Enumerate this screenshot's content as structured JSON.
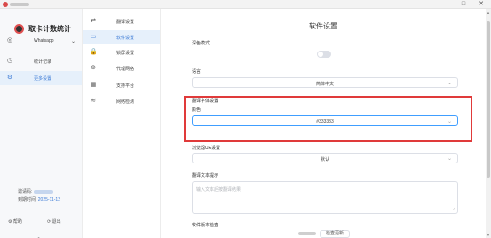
{
  "window": {
    "minimize": "–",
    "maximize": "□",
    "close": "✕"
  },
  "sidebar": {
    "app_title": "取卡计数统计",
    "items": [
      {
        "label": "Whatsapp",
        "icon": "whatsapp-icon",
        "glyph": "◎",
        "chevron": "⌄"
      },
      {
        "label": "统计记录",
        "icon": "history-icon",
        "glyph": "◷"
      },
      {
        "label": "更多设置",
        "icon": "gear-icon",
        "glyph": "⚙"
      }
    ],
    "account_label": "邀请码:",
    "expire_label": "到期时间:",
    "expire_value": "2025-11-12",
    "settings_action": "⚙ 帮助",
    "logout_action": "⟳ 退出",
    "collapse": "<"
  },
  "subnav": {
    "items": [
      {
        "label": "翻译设置",
        "icon": "translate-icon",
        "glyph": "⇄"
      },
      {
        "label": "软件设置",
        "icon": "monitor-icon",
        "glyph": "▭"
      },
      {
        "label": "锁屏设置",
        "icon": "lock-icon",
        "glyph": "🔒"
      },
      {
        "label": "代理网络",
        "icon": "globe-icon",
        "glyph": "⊕"
      },
      {
        "label": "支持平台",
        "icon": "grid-icon",
        "glyph": "▦"
      },
      {
        "label": "网络检测",
        "icon": "wifi-icon",
        "glyph": "≋"
      }
    ]
  },
  "main": {
    "title": "软件设置",
    "dark_mode_label": "深色模式",
    "language_label": "语言",
    "language_value": "简体中文",
    "translate_section_label": "翻译字体设置",
    "color_label": "颜色",
    "color_value": "#333333",
    "browser_ua_label": "浏览器UA设置",
    "browser_ua_value": "默认",
    "translate_text_label": "翻译文本提示",
    "translate_text_placeholder": "输入文本后按翻译结果",
    "version_label": "软件版本检查",
    "version_button": "检查更新",
    "accent_color": "#409eff",
    "highlight_color": "#e03a3a"
  }
}
